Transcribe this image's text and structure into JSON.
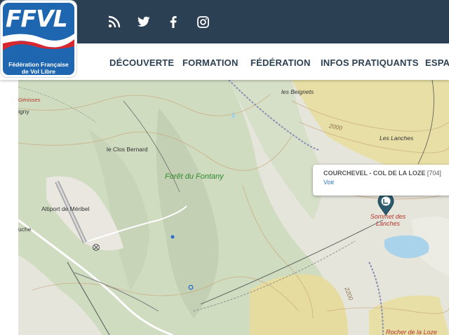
{
  "logo": {
    "title": "FFVL",
    "line1": "Fédération Française",
    "line2": "de Vol Libre"
  },
  "social": [
    {
      "name": "rss-icon"
    },
    {
      "name": "twitter-icon"
    },
    {
      "name": "facebook-icon"
    },
    {
      "name": "instagram-icon"
    }
  ],
  "nav": {
    "items": [
      "DÉCOUVERTE",
      "FORMATION",
      "FÉDÉRATION",
      "INFOS PRATIQUANTS",
      "ESPAC"
    ]
  },
  "map": {
    "labels": {
      "les_beignets": "les Beignets",
      "contour_2000": "2000",
      "les_lanches": "Les Lanches",
      "le_clos_bernard": "le Clos Bernard",
      "foret_du_fontany": "Forêt du Fontany",
      "altiport": "Altiport de Méribel",
      "sommet_des_lanches": "Sommet des Lanches",
      "contour_2200": "2200",
      "rocher_de_la_loze": "Rocher de la Loze",
      "genisses": "Génisses",
      "igny": "igny",
      "uche": "uche"
    },
    "popup": {
      "title": "COURCHEVEL - COL DE LA LOZE",
      "code": "[704]",
      "link": "Voir"
    },
    "colors": {
      "terrain": "#e6e5dc",
      "forest": "#cfdcc0",
      "meadow": "#e8dfa6",
      "lake": "#a9d3ea",
      "marker": "#2b5a6e"
    }
  }
}
